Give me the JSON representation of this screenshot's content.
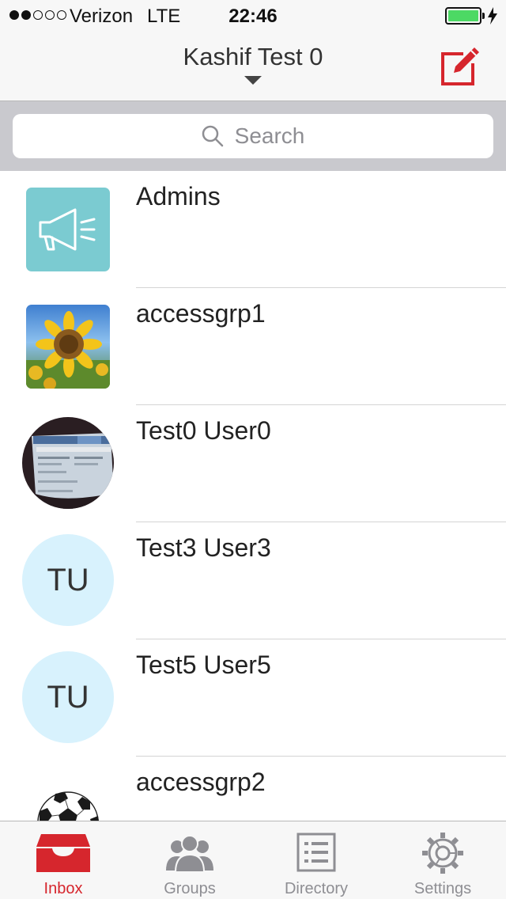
{
  "status_bar": {
    "signal_total": 5,
    "signal_filled": 2,
    "carrier": "Verizon",
    "network": "LTE",
    "time": "22:46",
    "battery_level": 1.0,
    "charging": true
  },
  "nav": {
    "title": "Kashif Test 0",
    "dropdown_icon": "caret-down-icon",
    "compose_icon": "compose-icon"
  },
  "search": {
    "placeholder": "Search",
    "icon": "search-icon"
  },
  "conversations": [
    {
      "name": "Admins",
      "avatar": "megaphone-icon"
    },
    {
      "name": "accessgrp1",
      "avatar": "sunflower-photo"
    },
    {
      "name": "Test0 User0",
      "avatar": "screen-photo"
    },
    {
      "name": "Test3 User3",
      "avatar": "initials",
      "initials": "TU"
    },
    {
      "name": "Test5 User5",
      "avatar": "initials",
      "initials": "TU"
    },
    {
      "name": "accessgrp2",
      "avatar": "soccer-ball-photo"
    }
  ],
  "tabs": [
    {
      "label": "Inbox",
      "icon": "inbox-icon",
      "active": true
    },
    {
      "label": "Groups",
      "icon": "groups-icon",
      "active": false
    },
    {
      "label": "Directory",
      "icon": "directory-icon",
      "active": false
    },
    {
      "label": "Settings",
      "icon": "settings-icon",
      "active": false
    }
  ],
  "colors": {
    "accent": "#d6262d",
    "battery": "#4cd964",
    "megaphone_tile": "#7bcbd1",
    "initials_avatar": "#d8f2fd"
  }
}
